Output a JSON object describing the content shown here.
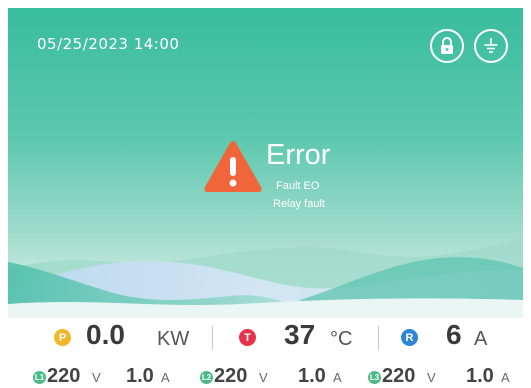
{
  "header": {
    "datetime": "05/25/2023  14:00",
    "lock_icon": "lock-icon",
    "ground_icon": "ground-icon"
  },
  "status": {
    "title": "Error",
    "code": "Fault EO",
    "description": "Relay fault",
    "icon": "warning-icon",
    "color": "#f0663a"
  },
  "metrics": {
    "power": {
      "badge": "P",
      "value": "0.0",
      "unit": "KW",
      "color": "#f2b62a"
    },
    "temperature": {
      "badge": "T",
      "value": "37",
      "unit": "°C",
      "color": "#e8314a"
    },
    "current": {
      "badge": "R",
      "value": "6",
      "unit": "A",
      "color": "#2f86d8"
    }
  },
  "lines": [
    {
      "badge": "L1",
      "voltage": "220",
      "voltage_unit": "V",
      "current": "1.0",
      "current_unit": "A"
    },
    {
      "badge": "L2",
      "voltage": "220",
      "voltage_unit": "V",
      "current": "1.0",
      "current_unit": "A"
    },
    {
      "badge": "L3",
      "voltage": "220",
      "voltage_unit": "V",
      "current": "1.0",
      "current_unit": "A"
    }
  ],
  "colors": {
    "top": "#38bd9c",
    "mid": "#8fd6c3",
    "wave": "#63c7b4"
  }
}
